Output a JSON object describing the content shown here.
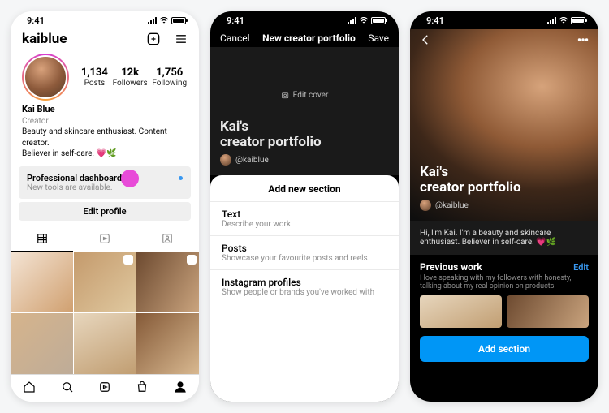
{
  "status": {
    "time": "9:41"
  },
  "profile": {
    "username": "kaiblue",
    "name": "Kai Blue",
    "category": "Creator",
    "stats": {
      "posts": {
        "count": "1,134",
        "label": "Posts"
      },
      "followers": {
        "count": "12k",
        "label": "Followers"
      },
      "following": {
        "count": "1,756",
        "label": "Following"
      }
    },
    "bio_line1": "Beauty and skincare enthusiast. Content creator.",
    "bio_line2": "Believer in self-care.",
    "bio_emoji": "💗🌿",
    "pro_dashboard": {
      "title": "Professional dashboard",
      "subtitle": "New tools are available."
    },
    "edit_profile": "Edit profile"
  },
  "creator_modal": {
    "cancel": "Cancel",
    "title": "New creator portfolio",
    "save": "Save",
    "edit_cover": "Edit cover",
    "cover_title_1": "Kai's",
    "cover_title_2": "creator portfolio",
    "handle": "@kaiblue",
    "sheet_title": "Add new section",
    "options": [
      {
        "title": "Text",
        "subtitle": "Describe your work"
      },
      {
        "title": "Posts",
        "subtitle": "Showcase your favourite posts and reels"
      },
      {
        "title": "Instagram profiles",
        "subtitle": "Show people or brands you've worked with"
      }
    ]
  },
  "portfolio": {
    "cover_title_1": "Kai's",
    "cover_title_2": "creator portfolio",
    "handle": "@kaiblue",
    "intro": "Hi, I'm Kai. I'm a beauty and skincare enthusiast. Believer in self-care.",
    "intro_emoji": "💗🌿",
    "previous_work": "Previous work",
    "edit": "Edit",
    "prev_sub": "I love speaking with my followers with honesty, talking about my real opinion on products.",
    "add_section": "Add section"
  }
}
